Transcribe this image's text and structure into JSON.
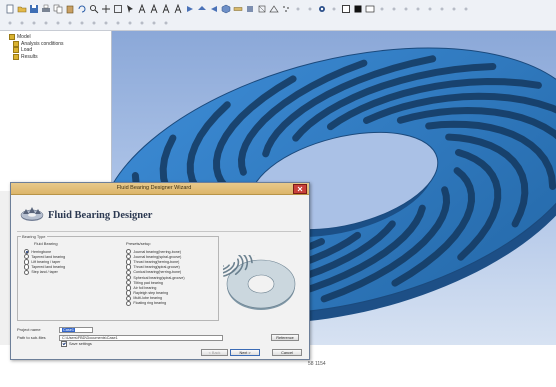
{
  "toolbar": {
    "row1_icons": [
      "new-file-icon",
      "open-icon",
      "save-icon",
      "print-icon",
      "copy-icon",
      "paste-icon",
      "rotate-icon",
      "zoom-icon",
      "pan-icon",
      "fit-icon",
      "select-icon",
      "text-a-icon",
      "text-a-icon",
      "text-a-icon",
      "text-a-icon",
      "view-front-icon",
      "view-top-icon",
      "view-side-icon",
      "view-iso-icon",
      "ruler-icon",
      "shade-icon",
      "wire-icon",
      "edges-icon",
      "points-icon",
      "dot-icon",
      "dot-icon",
      "target-icon",
      "dot-icon",
      "square-outline-icon",
      "square-black-icon",
      "window-icon",
      "dot-icon",
      "dot-icon",
      "dot-icon",
      "dot-icon",
      "dot-icon",
      "dot-icon",
      "dot-icon",
      "dot-icon"
    ],
    "row2_icons": [
      "dot-icon",
      "dot-icon",
      "dot-icon",
      "dot-icon",
      "dot-icon",
      "dot-icon",
      "dot-icon",
      "dot-icon",
      "dot-icon",
      "dot-icon",
      "dot-icon",
      "dot-icon",
      "dot-icon",
      "dot-icon"
    ]
  },
  "tree": {
    "items": [
      "Model",
      "Analysis conditions",
      "Load",
      "Results"
    ]
  },
  "status": {
    "text": "58 1154"
  },
  "colors": {
    "bearing_blue": "#2f79bf",
    "bearing_dark": "#1d4f86",
    "groove_dark": "#14385f",
    "viewport_bg": "#aac1e6",
    "titlebar": "#dcb56a"
  },
  "wizard": {
    "title": "Fluid Bearing Designer Wizard",
    "brand": "Fluid Bearing Designer",
    "bearing_type_legend": "Bearing Type",
    "fluid_header": "Fluid Bearing",
    "fluid_options": [
      {
        "label": "Herringbone",
        "selected": true
      },
      {
        "label": "Tapered land bearing",
        "selected": false
      },
      {
        "label": "Lift bearing / taper",
        "selected": false
      },
      {
        "label": "Tapered land bearing",
        "selected": false
      },
      {
        "label": "Step land / taper",
        "selected": false
      }
    ],
    "preset_header": "Presets/setup",
    "preset_options": [
      {
        "label": "Journal bearing(herring-bone)",
        "selected": false
      },
      {
        "label": "Journal bearing(spiral-groove)",
        "selected": false
      },
      {
        "label": "Thrust bearing(herring-bone)",
        "selected": false
      },
      {
        "label": "Thrust bearing(spiral-groove)",
        "selected": false
      },
      {
        "label": "Conical bearing(herring-bone)",
        "selected": false
      },
      {
        "label": "Spherical bearing(spiral-groove)",
        "selected": false
      },
      {
        "label": "Tilting pad bearing",
        "selected": false
      },
      {
        "label": "Air foil bearing",
        "selected": false
      },
      {
        "label": "Rayleigh step bearing",
        "selected": false
      },
      {
        "label": "Multi-lobe bearing",
        "selected": false
      },
      {
        "label": "Floating ring bearing",
        "selected": false
      }
    ],
    "project_name_label": "Project name",
    "project_name_value": "Case1",
    "path_label": "Path to sub-files",
    "path_value": "C:\\Users\\FBD\\Documents\\Case1",
    "browse_label": "Reference",
    "check_label": "Save settings",
    "check_checked": true,
    "back_label": "< Back",
    "next_label": "Next >",
    "cancel_label": "Cancel"
  }
}
